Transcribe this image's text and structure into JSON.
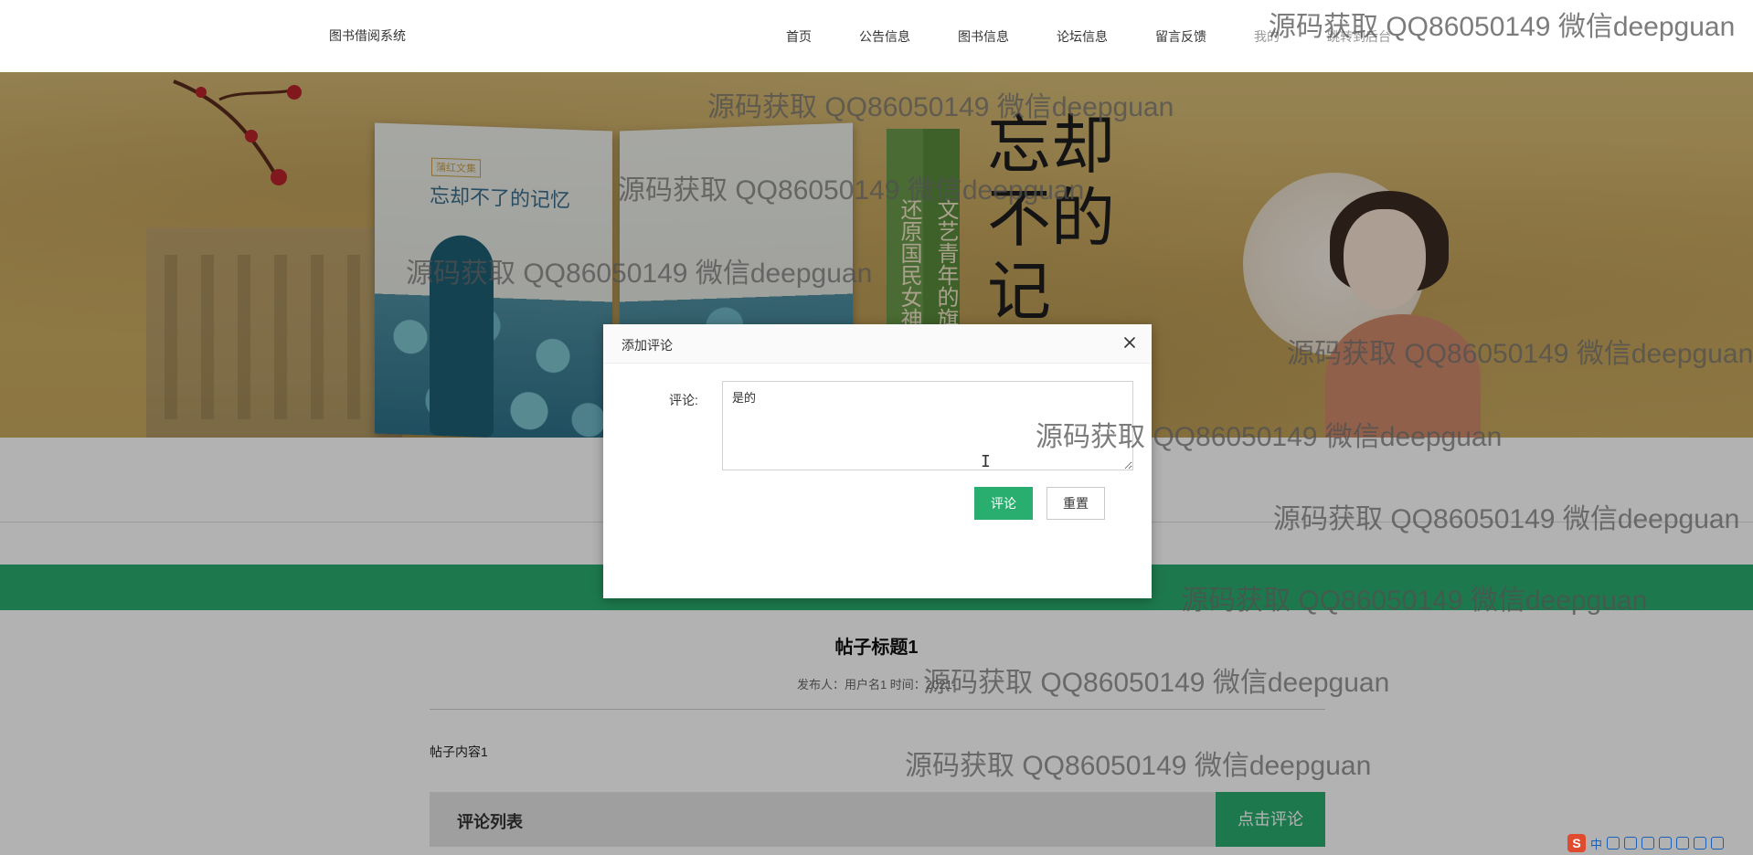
{
  "header": {
    "brand": "图书借阅系统",
    "nav": [
      "首页",
      "公告信息",
      "图书信息",
      "论坛信息",
      "留言反馈",
      "我的",
      "跳转到后台"
    ]
  },
  "banner": {
    "book_title": "忘却不了的记忆",
    "book_series": "蒲红文集",
    "strip_a": "还原国民女神的",
    "strip_b": "文艺青年的旗帜",
    "calligraphy": "忘却不的记"
  },
  "post": {
    "title": "帖子标题1",
    "meta": "发布人：用户名1 时间：2021-",
    "content": "帖子内容1",
    "comment_list_title": "评论列表",
    "comment_button": "点击评论"
  },
  "modal": {
    "title": "添加评论",
    "label": "评论:",
    "value": "是的",
    "submit": "评论",
    "reset": "重置"
  },
  "watermark": "源码获取 QQ86050149 微信deepguan",
  "tray": {
    "logo": "S",
    "lang": "中"
  },
  "colors": {
    "accent_green": "#2aae6f",
    "banner_tan": "#cfb066"
  },
  "icons": [
    "close-icon",
    "ibeam-cursor-icon",
    "sogou-ime-icon"
  ]
}
